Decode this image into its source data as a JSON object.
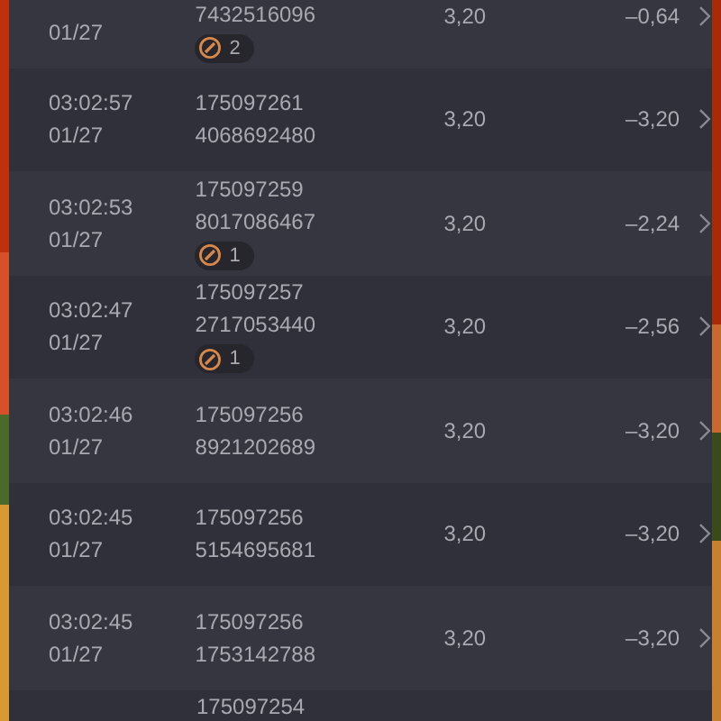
{
  "rows": [
    {
      "date": "01/27",
      "id_lines": [
        "7432516096"
      ],
      "badge": "2",
      "amount": "3,20",
      "result": "–0,64"
    },
    {
      "time": "03:02:57",
      "date": "01/27",
      "id_lines": [
        "175097261",
        "4068692480"
      ],
      "amount": "3,20",
      "result": "–3,20"
    },
    {
      "time": "03:02:53",
      "date": "01/27",
      "id_lines": [
        "175097259",
        "8017086467"
      ],
      "badge": "1",
      "amount": "3,20",
      "result": "–2,24"
    },
    {
      "time": "03:02:47",
      "date": "01/27",
      "id_lines": [
        "175097257",
        "2717053440"
      ],
      "badge": "1",
      "amount": "3,20",
      "result": "–2,56"
    },
    {
      "time": "03:02:46",
      "date": "01/27",
      "id_lines": [
        "175097256",
        "8921202689"
      ],
      "amount": "3,20",
      "result": "–3,20"
    },
    {
      "time": "03:02:45",
      "date": "01/27",
      "id_lines": [
        "175097256",
        "5154695681"
      ],
      "amount": "3,20",
      "result": "–3,20"
    },
    {
      "time": "03:02:45",
      "date": "01/27",
      "id_lines": [
        "175097256",
        "1753142788"
      ],
      "amount": "3,20",
      "result": "–3,20"
    },
    {
      "id_lines": [
        "175097254"
      ]
    }
  ]
}
